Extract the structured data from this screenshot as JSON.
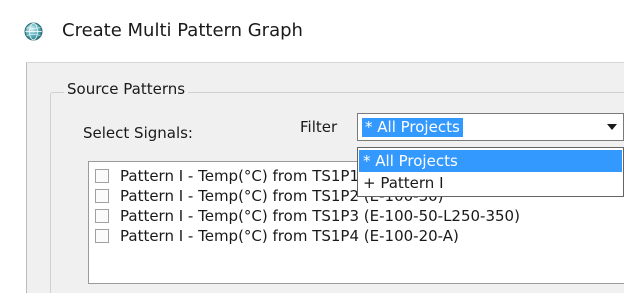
{
  "window": {
    "title": "Create Multi Pattern Graph",
    "icon": "globe-icon"
  },
  "source_patterns": {
    "group_label": "Source Patterns",
    "select_signals_label": "Select Signals:",
    "filter": {
      "label": "Filter",
      "selected_value": "* All Projects",
      "options": [
        "* All Projects",
        "+ Pattern I"
      ],
      "highlighted_index": 0
    },
    "signals": [
      {
        "label": "Pattern I - Temp(°C) from TS1P1 (E-100-50)",
        "checked": false
      },
      {
        "label": "Pattern I - Temp(°C) from TS1P2 (E-100-30)",
        "checked": false
      },
      {
        "label": "Pattern I - Temp(°C) from TS1P3 (E-100-50-L250-350)",
        "checked": false
      },
      {
        "label": "Pattern I - Temp(°C) from TS1P4 (E-100-20-A)",
        "checked": false
      }
    ]
  },
  "colors": {
    "selection": "#3399ff",
    "dialog_bg": "#f0f0f0"
  }
}
